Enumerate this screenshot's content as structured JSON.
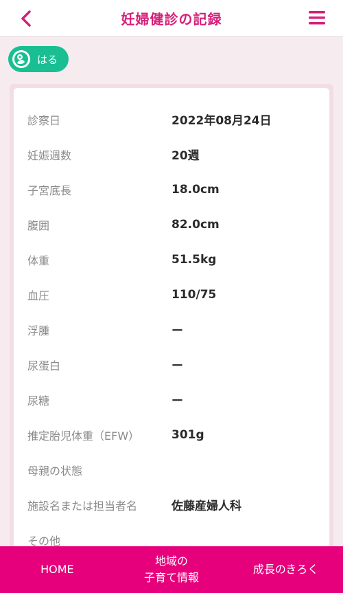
{
  "header": {
    "title": "妊婦健診の記録",
    "back_icon": "chevron-left-icon",
    "menu_icon": "hamburger-menu-icon",
    "accent": "#d61f7a"
  },
  "profile": {
    "name": "はる",
    "avatar_icon": "baby-icon",
    "color": "#19bf92"
  },
  "record": {
    "rows": [
      {
        "label": "診察日",
        "value": "2022年08月24日"
      },
      {
        "label": "妊娠週数",
        "value": "20週"
      },
      {
        "label": "子宮底長",
        "value": "18.0cm"
      },
      {
        "label": "腹囲",
        "value": "82.0cm"
      },
      {
        "label": "体重",
        "value": "51.5kg"
      },
      {
        "label": "血圧",
        "value": "110/75"
      },
      {
        "label": "浮腫",
        "value": "ー"
      },
      {
        "label": "尿蛋白",
        "value": "ー"
      },
      {
        "label": "尿糖",
        "value": "ー"
      },
      {
        "label": "推定胎児体重（EFW）",
        "value": "301g"
      },
      {
        "label": "母親の状態",
        "value": ""
      },
      {
        "label": "施設名または担当者名",
        "value": "佐藤産婦人科"
      },
      {
        "label": "その他",
        "value": ""
      }
    ]
  },
  "bottom_nav": {
    "home": "HOME",
    "local_line1": "地域の",
    "local_line2": "子育て情報",
    "growth": "成長のきろく",
    "color": "#e6007c"
  }
}
